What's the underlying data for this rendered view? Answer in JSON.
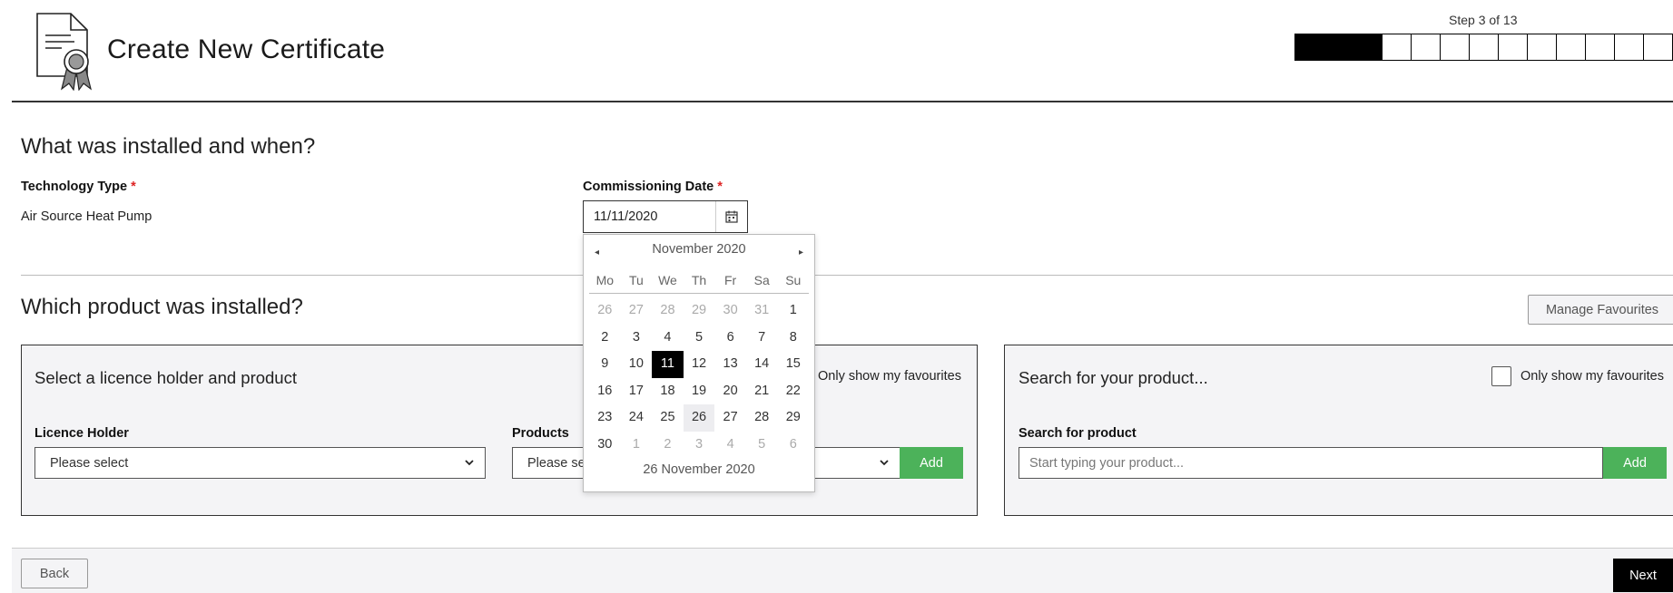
{
  "header": {
    "title": "Create New Certificate",
    "step_label": "Step 3 of 13",
    "total_steps": 13,
    "completed_steps": 3
  },
  "installed": {
    "heading": "What was installed and when?",
    "technology_label": "Technology Type",
    "technology_value": "Air Source Heat Pump",
    "date_label": "Commissioning Date",
    "date_value": "11/11/2020",
    "required_marker": "*"
  },
  "product": {
    "heading": "Which product was installed?",
    "manage_favourites": "Manage Favourites",
    "licence_panel": {
      "title": "Select a licence holder and product",
      "favourites_label": "Only show my favourites",
      "licence_holder_label": "Licence Holder",
      "licence_holder_value": "Please select",
      "products_label": "Products",
      "products_value": "Please select",
      "add_label": "Add"
    },
    "search_panel": {
      "title": "Search for your product...",
      "favourites_label": "Only show my favourites",
      "search_label": "Search for product",
      "search_placeholder": "Start typing your product...",
      "add_label": "Add"
    }
  },
  "footer": {
    "back_label": "Back",
    "next_label": "Next"
  },
  "datepicker": {
    "month_label": "November 2020",
    "prev_icon": "◂",
    "next_icon": "▸",
    "weekdays": [
      "Mo",
      "Tu",
      "We",
      "Th",
      "Fr",
      "Sa",
      "Su"
    ],
    "weeks": [
      [
        {
          "d": "26",
          "o": true
        },
        {
          "d": "27",
          "o": true
        },
        {
          "d": "28",
          "o": true
        },
        {
          "d": "29",
          "o": true
        },
        {
          "d": "30",
          "o": true
        },
        {
          "d": "31",
          "o": true
        },
        {
          "d": "1"
        }
      ],
      [
        {
          "d": "2"
        },
        {
          "d": "3"
        },
        {
          "d": "4"
        },
        {
          "d": "5"
        },
        {
          "d": "6"
        },
        {
          "d": "7"
        },
        {
          "d": "8"
        }
      ],
      [
        {
          "d": "9"
        },
        {
          "d": "10"
        },
        {
          "d": "11",
          "s": true
        },
        {
          "d": "12"
        },
        {
          "d": "13"
        },
        {
          "d": "14"
        },
        {
          "d": "15"
        }
      ],
      [
        {
          "d": "16"
        },
        {
          "d": "17"
        },
        {
          "d": "18"
        },
        {
          "d": "19"
        },
        {
          "d": "20"
        },
        {
          "d": "21"
        },
        {
          "d": "22"
        }
      ],
      [
        {
          "d": "23"
        },
        {
          "d": "24"
        },
        {
          "d": "25"
        },
        {
          "d": "26",
          "t": true
        },
        {
          "d": "27"
        },
        {
          "d": "28"
        },
        {
          "d": "29"
        }
      ],
      [
        {
          "d": "30"
        },
        {
          "d": "1",
          "o": true
        },
        {
          "d": "2",
          "o": true
        },
        {
          "d": "3",
          "o": true
        },
        {
          "d": "4",
          "o": true
        },
        {
          "d": "5",
          "o": true
        },
        {
          "d": "6",
          "o": true
        }
      ]
    ],
    "today_label": "26 November 2020"
  },
  "colors": {
    "accent_green": "#4cb25a",
    "required_red": "#dd2222",
    "panel_bg": "#f4f4f6"
  }
}
